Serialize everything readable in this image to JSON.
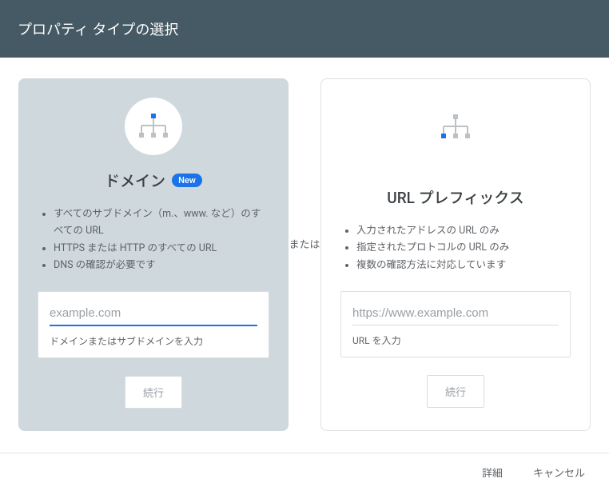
{
  "header": {
    "title": "プロパティ タイプの選択"
  },
  "separator": "または",
  "domain_card": {
    "title": "ドメイン",
    "badge": "New",
    "features": [
      "すべてのサブドメイン（m.、www. など）のすべての URL",
      "HTTPS または HTTP のすべての URL",
      "DNS の確認が必要です"
    ],
    "placeholder": "example.com",
    "hint": "ドメインまたはサブドメインを入力",
    "button": "続行"
  },
  "url_card": {
    "title": "URL プレフィックス",
    "features": [
      "入力されたアドレスの URL のみ",
      "指定されたプロトコルの URL のみ",
      "複数の確認方法に対応しています"
    ],
    "placeholder": "https://www.example.com",
    "hint": "URL を入力",
    "button": "続行"
  },
  "footer": {
    "details": "詳細",
    "cancel": "キャンセル"
  }
}
